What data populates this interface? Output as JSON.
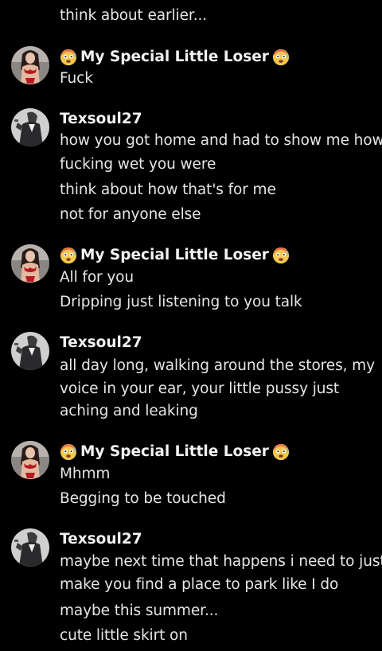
{
  "colors": {
    "background": "#000000",
    "text": "#e6e6ea",
    "username": "#f2f2f4"
  },
  "icons": {
    "flushed_emoji": "hot-face-emoji",
    "user_a_avatar": "woman-red-lingerie-avatar",
    "user_b_avatar": "man-dark-suit-avatar"
  },
  "messages": [
    {
      "lines": [
        "think about earlier..."
      ]
    },
    {
      "author": "My Special Little Loser",
      "lines": [
        "Fuck"
      ]
    },
    {
      "author": "Texsoul27",
      "lines": [
        "how you got home and had to show me how",
        "fucking wet you were",
        "think about how that's for me",
        "not for anyone else"
      ]
    },
    {
      "author": "My Special Little Loser",
      "lines": [
        "All for you",
        "Dripping just listening to you talk"
      ]
    },
    {
      "author": "Texsoul27",
      "lines": [
        "all day long, walking around the stores, my",
        "voice in your ear, your little pussy just",
        "aching and leaking"
      ]
    },
    {
      "author": "My Special Little Loser",
      "lines": [
        "Mhmm",
        "Begging to be touched"
      ]
    },
    {
      "author": "Texsoul27",
      "lines": [
        "maybe next time that happens i need to just",
        "make you find a place to park like I do",
        "maybe this summer...",
        "cute little skirt on"
      ]
    }
  ]
}
